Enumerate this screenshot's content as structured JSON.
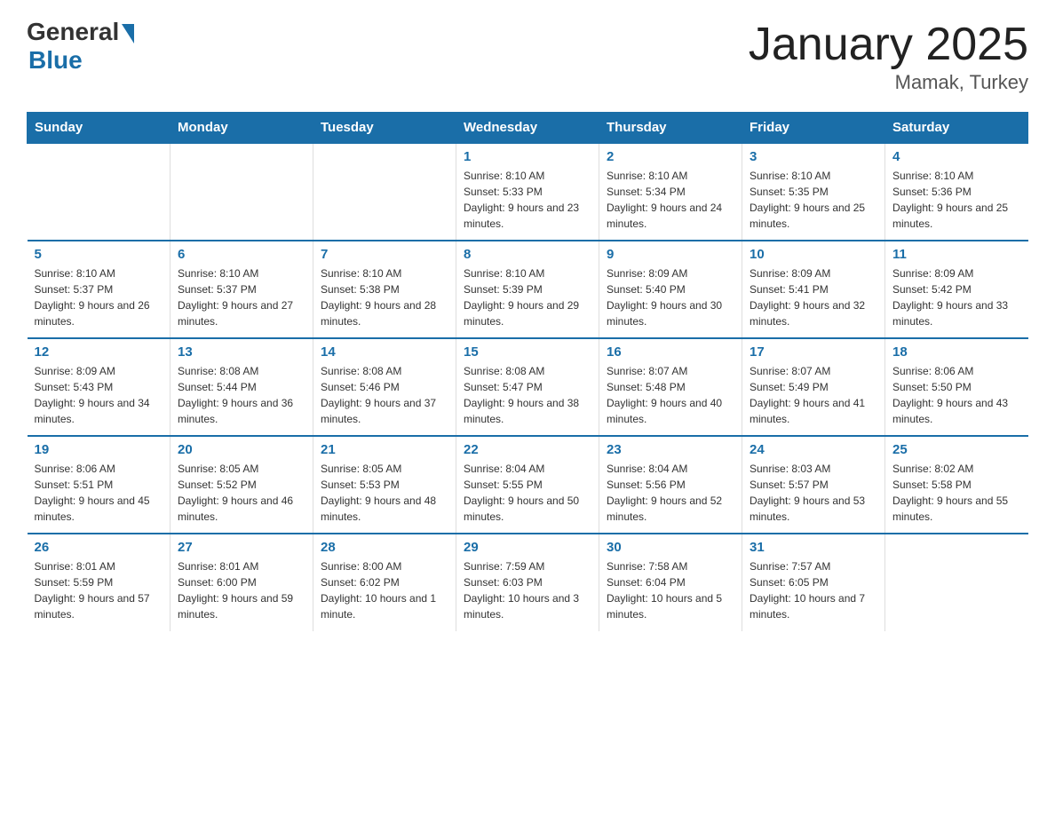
{
  "header": {
    "logo_general": "General",
    "logo_blue": "Blue",
    "title": "January 2025",
    "subtitle": "Mamak, Turkey"
  },
  "days_of_week": [
    "Sunday",
    "Monday",
    "Tuesday",
    "Wednesday",
    "Thursday",
    "Friday",
    "Saturday"
  ],
  "weeks": [
    [
      {
        "day": "",
        "info": ""
      },
      {
        "day": "",
        "info": ""
      },
      {
        "day": "",
        "info": ""
      },
      {
        "day": "1",
        "info": "Sunrise: 8:10 AM\nSunset: 5:33 PM\nDaylight: 9 hours and 23 minutes."
      },
      {
        "day": "2",
        "info": "Sunrise: 8:10 AM\nSunset: 5:34 PM\nDaylight: 9 hours and 24 minutes."
      },
      {
        "day": "3",
        "info": "Sunrise: 8:10 AM\nSunset: 5:35 PM\nDaylight: 9 hours and 25 minutes."
      },
      {
        "day": "4",
        "info": "Sunrise: 8:10 AM\nSunset: 5:36 PM\nDaylight: 9 hours and 25 minutes."
      }
    ],
    [
      {
        "day": "5",
        "info": "Sunrise: 8:10 AM\nSunset: 5:37 PM\nDaylight: 9 hours and 26 minutes."
      },
      {
        "day": "6",
        "info": "Sunrise: 8:10 AM\nSunset: 5:37 PM\nDaylight: 9 hours and 27 minutes."
      },
      {
        "day": "7",
        "info": "Sunrise: 8:10 AM\nSunset: 5:38 PM\nDaylight: 9 hours and 28 minutes."
      },
      {
        "day": "8",
        "info": "Sunrise: 8:10 AM\nSunset: 5:39 PM\nDaylight: 9 hours and 29 minutes."
      },
      {
        "day": "9",
        "info": "Sunrise: 8:09 AM\nSunset: 5:40 PM\nDaylight: 9 hours and 30 minutes."
      },
      {
        "day": "10",
        "info": "Sunrise: 8:09 AM\nSunset: 5:41 PM\nDaylight: 9 hours and 32 minutes."
      },
      {
        "day": "11",
        "info": "Sunrise: 8:09 AM\nSunset: 5:42 PM\nDaylight: 9 hours and 33 minutes."
      }
    ],
    [
      {
        "day": "12",
        "info": "Sunrise: 8:09 AM\nSunset: 5:43 PM\nDaylight: 9 hours and 34 minutes."
      },
      {
        "day": "13",
        "info": "Sunrise: 8:08 AM\nSunset: 5:44 PM\nDaylight: 9 hours and 36 minutes."
      },
      {
        "day": "14",
        "info": "Sunrise: 8:08 AM\nSunset: 5:46 PM\nDaylight: 9 hours and 37 minutes."
      },
      {
        "day": "15",
        "info": "Sunrise: 8:08 AM\nSunset: 5:47 PM\nDaylight: 9 hours and 38 minutes."
      },
      {
        "day": "16",
        "info": "Sunrise: 8:07 AM\nSunset: 5:48 PM\nDaylight: 9 hours and 40 minutes."
      },
      {
        "day": "17",
        "info": "Sunrise: 8:07 AM\nSunset: 5:49 PM\nDaylight: 9 hours and 41 minutes."
      },
      {
        "day": "18",
        "info": "Sunrise: 8:06 AM\nSunset: 5:50 PM\nDaylight: 9 hours and 43 minutes."
      }
    ],
    [
      {
        "day": "19",
        "info": "Sunrise: 8:06 AM\nSunset: 5:51 PM\nDaylight: 9 hours and 45 minutes."
      },
      {
        "day": "20",
        "info": "Sunrise: 8:05 AM\nSunset: 5:52 PM\nDaylight: 9 hours and 46 minutes."
      },
      {
        "day": "21",
        "info": "Sunrise: 8:05 AM\nSunset: 5:53 PM\nDaylight: 9 hours and 48 minutes."
      },
      {
        "day": "22",
        "info": "Sunrise: 8:04 AM\nSunset: 5:55 PM\nDaylight: 9 hours and 50 minutes."
      },
      {
        "day": "23",
        "info": "Sunrise: 8:04 AM\nSunset: 5:56 PM\nDaylight: 9 hours and 52 minutes."
      },
      {
        "day": "24",
        "info": "Sunrise: 8:03 AM\nSunset: 5:57 PM\nDaylight: 9 hours and 53 minutes."
      },
      {
        "day": "25",
        "info": "Sunrise: 8:02 AM\nSunset: 5:58 PM\nDaylight: 9 hours and 55 minutes."
      }
    ],
    [
      {
        "day": "26",
        "info": "Sunrise: 8:01 AM\nSunset: 5:59 PM\nDaylight: 9 hours and 57 minutes."
      },
      {
        "day": "27",
        "info": "Sunrise: 8:01 AM\nSunset: 6:00 PM\nDaylight: 9 hours and 59 minutes."
      },
      {
        "day": "28",
        "info": "Sunrise: 8:00 AM\nSunset: 6:02 PM\nDaylight: 10 hours and 1 minute."
      },
      {
        "day": "29",
        "info": "Sunrise: 7:59 AM\nSunset: 6:03 PM\nDaylight: 10 hours and 3 minutes."
      },
      {
        "day": "30",
        "info": "Sunrise: 7:58 AM\nSunset: 6:04 PM\nDaylight: 10 hours and 5 minutes."
      },
      {
        "day": "31",
        "info": "Sunrise: 7:57 AM\nSunset: 6:05 PM\nDaylight: 10 hours and 7 minutes."
      },
      {
        "day": "",
        "info": ""
      }
    ]
  ]
}
